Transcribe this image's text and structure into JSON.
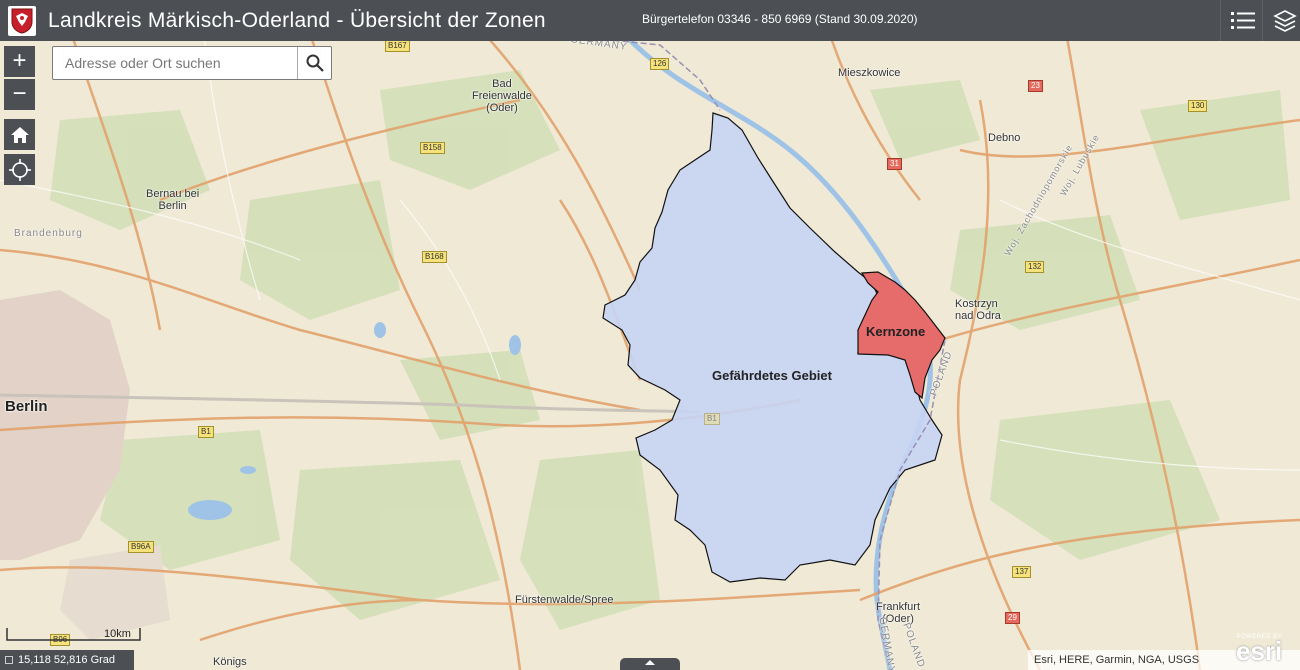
{
  "header": {
    "title": "Landkreis Märkisch-Oderland - Übersicht der Zonen",
    "subtitle": "Bürgertelefon 03346 - 850 6969 (Stand 30.09.2020)",
    "logo_icon": "coat-of-arms-icon",
    "legend_icon": "list-icon",
    "layers_icon": "layers-icon"
  },
  "map_controls": {
    "zoom_in": "+",
    "zoom_out": "−",
    "home_icon": "home-icon",
    "locate_icon": "locate-icon"
  },
  "search": {
    "placeholder": "Adresse oder Ort suchen",
    "value": "",
    "icon": "search-icon"
  },
  "zones": {
    "core": "Kernzone",
    "endangered": "Gefährdetes Gebiet",
    "core_color": "#e66b6b",
    "endangered_color": "#c6d4f4"
  },
  "places": {
    "berlin": "Berlin",
    "bernau": "Bernau bei\nBerlin",
    "bad_freienwalde": "Bad\nFreienwalde\n(Oder)",
    "mieszkowice": "Mieszkowice",
    "debno": "Debno",
    "kostrzyn": "Kostrzyn\nnad Odra",
    "fuerstenwalde": "Fürstenwalde/Spree",
    "frankfurt": "Frankfurt\n(Oder)",
    "koenigs": "Königs",
    "brandenburg": "Brandenburg",
    "germany": "GERMANY",
    "poland": "POLAND",
    "germany_bottom": "GERMANY",
    "poland_bottom": "POLAND",
    "woj_zachodniopomorskie": "Woj. Zachodniopomorskie",
    "woj_lubuskie": "Woj. Lubuskie"
  },
  "road_shields": {
    "b167": "B167",
    "b158": "B158",
    "b168": "B168",
    "b1": "B1",
    "b1_map": "B1",
    "b96a": "B96A",
    "b96": "B96",
    "r126": "126",
    "r23": "23",
    "r130": "130",
    "r31": "31",
    "r132": "132",
    "r137": "137",
    "r29": "29"
  },
  "scale": {
    "label": "10km"
  },
  "coordinates": {
    "text": "15,118 52,816 Grad"
  },
  "attribution": {
    "text": "Esri, HERE, Garmin, NGA, USGS",
    "powered_by": "POWERED BY",
    "esri": "esri"
  }
}
